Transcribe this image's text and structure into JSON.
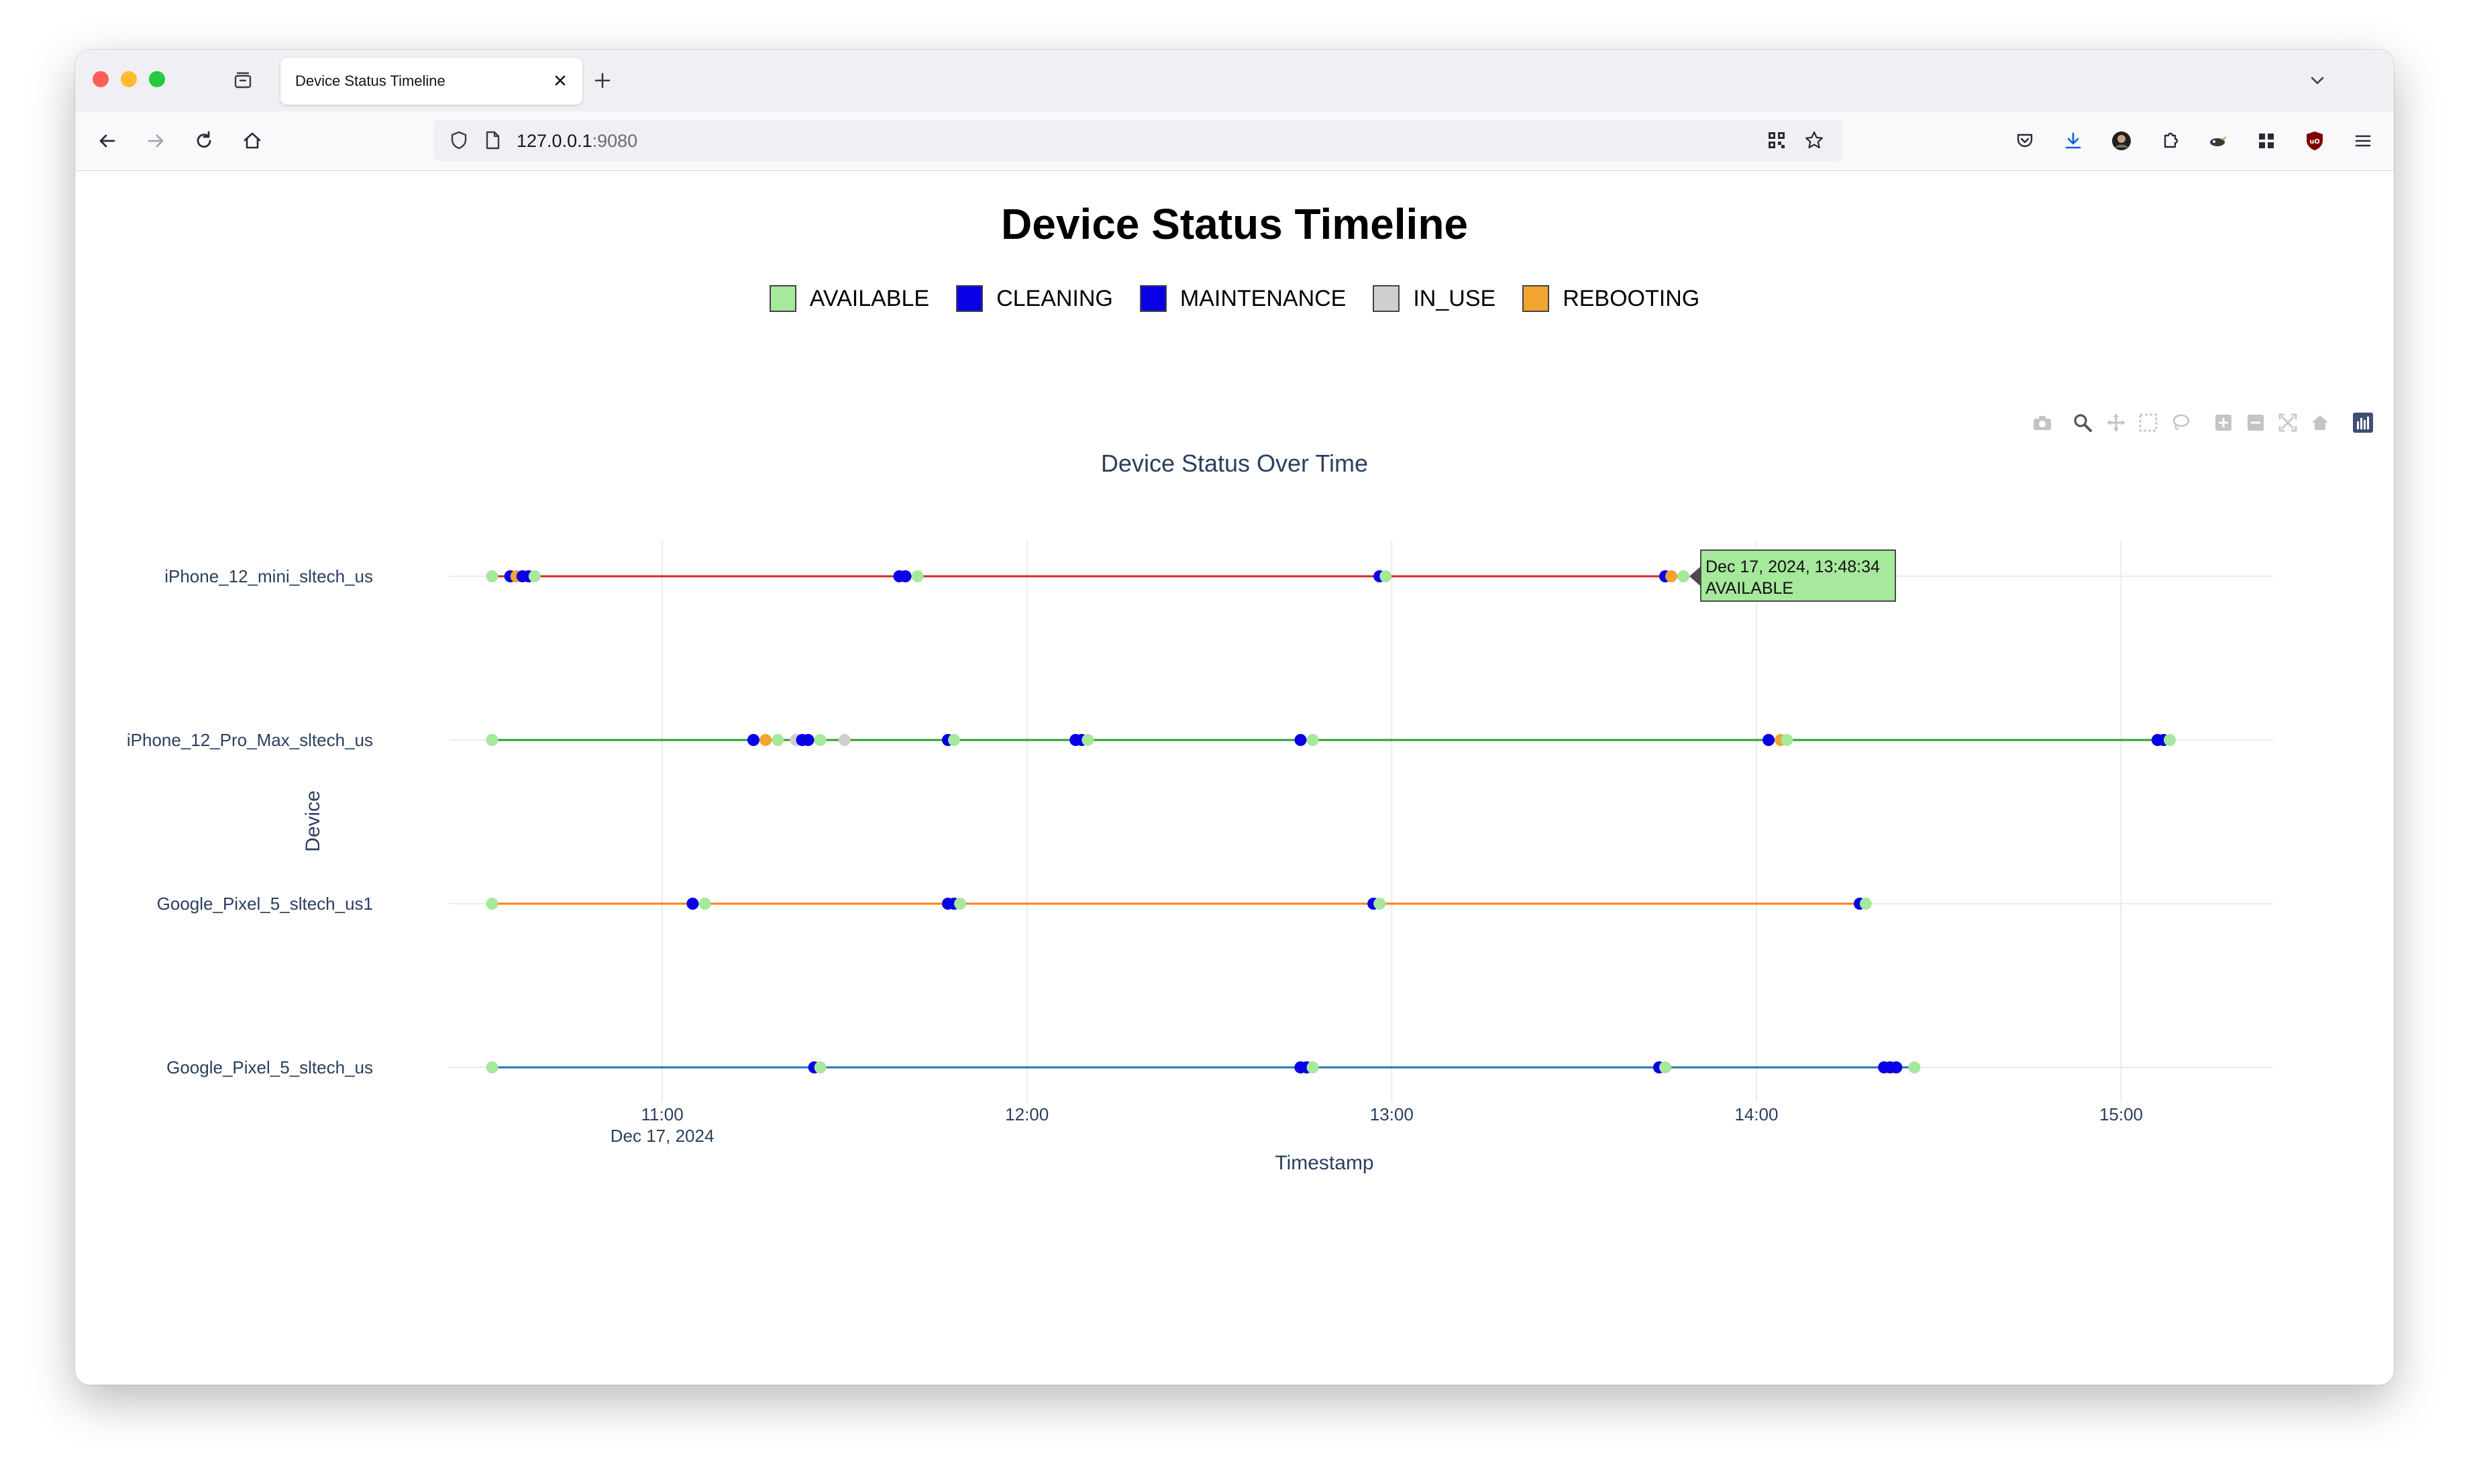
{
  "browser": {
    "tab_title": "Device Status Timeline",
    "url_host": "127.0.0.1",
    "url_port": ":9080"
  },
  "page": {
    "title": "Device Status Timeline"
  },
  "legend": [
    {
      "label": "AVAILABLE",
      "color": "#a6e89c"
    },
    {
      "label": "CLEANING",
      "color": "#0a00e6"
    },
    {
      "label": "MAINTENANCE",
      "color": "#0a00e6"
    },
    {
      "label": "IN_USE",
      "color": "#cfcfcf"
    },
    {
      "label": "REBOOTING",
      "color": "#f2a531"
    }
  ],
  "modebar": [
    "camera-icon",
    "zoom-icon",
    "pan-icon",
    "box-select-icon",
    "lasso-icon",
    "zoom-in-icon",
    "zoom-out-icon",
    "autoscale-icon",
    "reset-axes-icon",
    "plotly-logo-icon"
  ],
  "tooltip": {
    "line1": "Dec 17, 2024, 13:48:34",
    "line2": "AVAILABLE",
    "color": "#a6e89c"
  },
  "chart_data": {
    "type": "scatter",
    "title": "Device Status Over Time",
    "xlabel": "Timestamp",
    "ylabel": "Device",
    "date": "Dec 17, 2024",
    "x_range": [
      "10:25",
      "15:25"
    ],
    "x_ticks": [
      {
        "t": "11:00",
        "label": "11:00",
        "sublabel": "Dec 17, 2024"
      },
      {
        "t": "12:00",
        "label": "12:00"
      },
      {
        "t": "13:00",
        "label": "13:00"
      },
      {
        "t": "14:00",
        "label": "14:00"
      },
      {
        "t": "15:00",
        "label": "15:00"
      }
    ],
    "grid": true,
    "devices": [
      "iPhone_12_mini_sltech_us",
      "iPhone_12_Pro_Max_sltech_us",
      "Google_Pixel_5_sltech_us1",
      "Google_Pixel_5_sltech_us"
    ],
    "series": [
      {
        "name": "iPhone_12_mini_sltech_us",
        "line_color": "#d62728",
        "points": [
          {
            "t": "10:32",
            "status": "AVAILABLE"
          },
          {
            "t": "10:35",
            "status": "CLEANING"
          },
          {
            "t": "10:36",
            "status": "REBOOTING"
          },
          {
            "t": "10:37",
            "status": "MAINTENANCE"
          },
          {
            "t": "10:38",
            "status": "CLEANING"
          },
          {
            "t": "10:39",
            "status": "AVAILABLE"
          },
          {
            "t": "11:39",
            "status": "CLEANING"
          },
          {
            "t": "11:40",
            "status": "MAINTENANCE"
          },
          {
            "t": "11:42",
            "status": "AVAILABLE"
          },
          {
            "t": "12:58",
            "status": "CLEANING"
          },
          {
            "t": "12:59",
            "status": "AVAILABLE"
          },
          {
            "t": "13:45",
            "status": "CLEANING"
          },
          {
            "t": "13:46",
            "status": "REBOOTING"
          },
          {
            "t": "13:48",
            "status": "AVAILABLE"
          }
        ]
      },
      {
        "name": "iPhone_12_Pro_Max_sltech_us",
        "line_color": "#2ca02c",
        "points": [
          {
            "t": "10:32",
            "status": "AVAILABLE"
          },
          {
            "t": "11:15",
            "status": "CLEANING"
          },
          {
            "t": "11:17",
            "status": "REBOOTING"
          },
          {
            "t": "11:19",
            "status": "AVAILABLE"
          },
          {
            "t": "11:22",
            "status": "IN_USE"
          },
          {
            "t": "11:23",
            "status": "CLEANING"
          },
          {
            "t": "11:24",
            "status": "MAINTENANCE"
          },
          {
            "t": "11:26",
            "status": "AVAILABLE"
          },
          {
            "t": "11:30",
            "status": "IN_USE"
          },
          {
            "t": "11:47",
            "status": "CLEANING"
          },
          {
            "t": "11:48",
            "status": "AVAILABLE"
          },
          {
            "t": "12:08",
            "status": "CLEANING"
          },
          {
            "t": "12:09",
            "status": "MAINTENANCE"
          },
          {
            "t": "12:10",
            "status": "AVAILABLE"
          },
          {
            "t": "12:45",
            "status": "CLEANING"
          },
          {
            "t": "12:47",
            "status": "AVAILABLE"
          },
          {
            "t": "14:02",
            "status": "CLEANING"
          },
          {
            "t": "14:04",
            "status": "REBOOTING"
          },
          {
            "t": "14:05",
            "status": "AVAILABLE"
          },
          {
            "t": "15:06",
            "status": "CLEANING"
          },
          {
            "t": "15:07",
            "status": "MAINTENANCE"
          },
          {
            "t": "15:08",
            "status": "AVAILABLE"
          }
        ]
      },
      {
        "name": "Google_Pixel_5_sltech_us1",
        "line_color": "#ff7f0e",
        "points": [
          {
            "t": "10:32",
            "status": "AVAILABLE"
          },
          {
            "t": "11:05",
            "status": "CLEANING"
          },
          {
            "t": "11:07",
            "status": "AVAILABLE"
          },
          {
            "t": "11:47",
            "status": "CLEANING"
          },
          {
            "t": "11:48",
            "status": "MAINTENANCE"
          },
          {
            "t": "11:49",
            "status": "AVAILABLE"
          },
          {
            "t": "12:57",
            "status": "CLEANING"
          },
          {
            "t": "12:58",
            "status": "AVAILABLE"
          },
          {
            "t": "14:17",
            "status": "CLEANING"
          },
          {
            "t": "14:18",
            "status": "AVAILABLE"
          }
        ]
      },
      {
        "name": "Google_Pixel_5_sltech_us",
        "line_color": "#1f77b4",
        "points": [
          {
            "t": "10:32",
            "status": "AVAILABLE"
          },
          {
            "t": "11:25",
            "status": "CLEANING"
          },
          {
            "t": "11:26",
            "status": "AVAILABLE"
          },
          {
            "t": "12:45",
            "status": "CLEANING"
          },
          {
            "t": "12:46",
            "status": "MAINTENANCE"
          },
          {
            "t": "12:47",
            "status": "AVAILABLE"
          },
          {
            "t": "13:44",
            "status": "CLEANING"
          },
          {
            "t": "13:45",
            "status": "AVAILABLE"
          },
          {
            "t": "14:21",
            "status": "CLEANING"
          },
          {
            "t": "14:22",
            "status": "MAINTENANCE"
          },
          {
            "t": "14:23",
            "status": "CLEANING"
          },
          {
            "t": "14:26",
            "status": "AVAILABLE"
          }
        ]
      }
    ]
  }
}
